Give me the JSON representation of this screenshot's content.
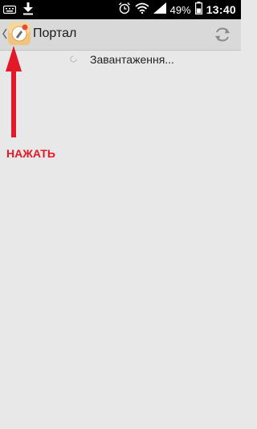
{
  "status_bar": {
    "battery_percent": "49%",
    "time": "13:40",
    "icons": [
      "keyboard-icon",
      "download-icon",
      "alarm-icon",
      "wifi-icon",
      "signal-icon",
      "battery-icon"
    ]
  },
  "action_bar": {
    "title": "Портал",
    "icons": [
      "up-caret-icon",
      "app-icon",
      "refresh-icon"
    ]
  },
  "content": {
    "loading_text": "Завантаження..."
  },
  "annotation": {
    "label": "НАЖАТЬ",
    "color": "#e3192a"
  }
}
